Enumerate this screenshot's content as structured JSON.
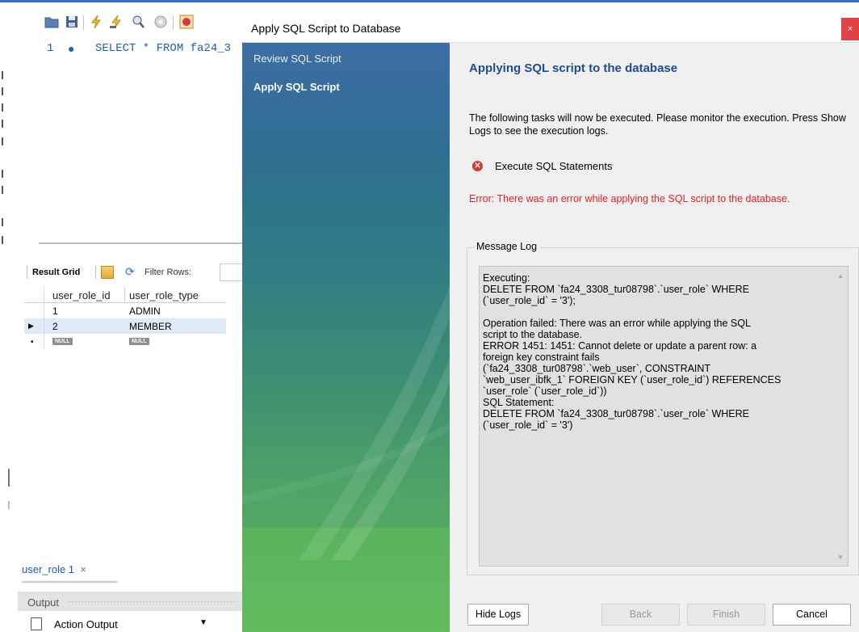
{
  "workbench": {
    "editor": {
      "line_number": "1",
      "line_marker": "●",
      "sql": "SELECT * FROM fa24_3"
    },
    "result_bar": {
      "result_grid_label": "Result Grid",
      "filter_rows_label": "Filter Rows:"
    },
    "grid": {
      "columns": [
        "user_role_id",
        "user_role_type"
      ],
      "rows": [
        {
          "id": "1",
          "type": "ADMIN"
        },
        {
          "id": "2",
          "type": "MEMBER"
        }
      ],
      "null_label": "NULL"
    },
    "tab": {
      "label": "user_role 1",
      "close": "×"
    },
    "output": {
      "label": "Output",
      "selected": "Action Output"
    }
  },
  "dialog": {
    "title": "Apply SQL Script to Database",
    "close_glyph": "×",
    "steps": [
      {
        "label": "Review SQL Script",
        "current": false
      },
      {
        "label": "Apply SQL Script",
        "current": true
      }
    ],
    "heading": "Applying SQL script to the database",
    "intro": "The following tasks will now be executed. Please monitor the execution. Press Show Logs to see the execution logs.",
    "task": {
      "label": "Execute SQL Statements",
      "status": "error"
    },
    "error_message": "Error: There was an error while applying the SQL script to the database.",
    "message_log": {
      "title": "Message Log",
      "text": "Executing:\nDELETE FROM `fa24_3308_tur08798`.`user_role` WHERE\n(`user_role_id` = '3');\n\nOperation failed: There was an error while applying the SQL\nscript to the database.\nERROR 1451: 1451: Cannot delete or update a parent row: a\nforeign key constraint fails\n(`fa24_3308_tur08798`.`web_user`, CONSTRAINT\n`web_user_ibfk_1` FOREIGN KEY (`user_role_id`) REFERENCES\n`user_role` (`user_role_id`))\nSQL Statement:\nDELETE FROM `fa24_3308_tur08798`.`user_role` WHERE\n(`user_role_id` = '3')"
    },
    "buttons": {
      "hide_logs": "Hide Logs",
      "back": "Back",
      "finish": "Finish",
      "cancel": "Cancel"
    }
  },
  "colors": {
    "heading": "#1e4c95",
    "error": "#e0202a",
    "close_button": "#e04343",
    "sidebar_top": "#3d6da5",
    "sidebar_bottom": "#5fb560"
  }
}
